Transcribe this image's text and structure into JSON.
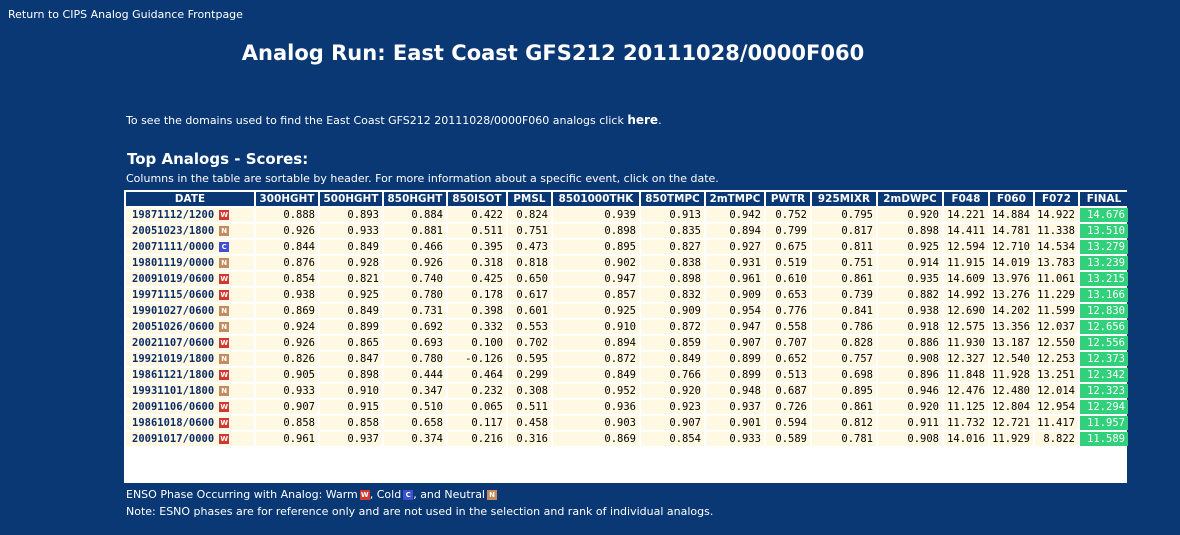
{
  "return_link": "Return to CIPS Analog Guidance Frontpage",
  "title": "Analog Run: East Coast GFS212 20111028/0000F060",
  "domains": {
    "text": "To see the domains used to find the East Coast GFS212 20111028/0000F060 analogs click",
    "link": "here",
    "end": "."
  },
  "section_title": "Top Analogs - Scores:",
  "sort_note": "Columns in the table are sortable by header. For more information about a specific event, click on the date.",
  "table": {
    "headers": [
      "DATE",
      "300HGHT",
      "500HGHT",
      "850HGHT",
      "850ISOT",
      "PMSL",
      "8501000THK",
      "850TMPC",
      "2mTMPC",
      "PWTR",
      "925MIXR",
      "2mDWPC",
      "F048",
      "F060",
      "F072",
      "FINAL"
    ],
    "rows": [
      {
        "date": "19871112/1200",
        "enso": "W",
        "values": [
          "0.888",
          "0.893",
          "0.884",
          "0.422",
          "0.824",
          "0.939",
          "0.913",
          "0.942",
          "0.752",
          "0.795",
          "0.920",
          "14.221",
          "14.884",
          "14.922",
          "14.676"
        ]
      },
      {
        "date": "20051023/1800",
        "enso": "N",
        "values": [
          "0.926",
          "0.933",
          "0.881",
          "0.511",
          "0.751",
          "0.898",
          "0.835",
          "0.894",
          "0.799",
          "0.817",
          "0.898",
          "14.411",
          "14.781",
          "11.338",
          "13.510"
        ]
      },
      {
        "date": "20071111/0000",
        "enso": "C",
        "values": [
          "0.844",
          "0.849",
          "0.466",
          "0.395",
          "0.473",
          "0.895",
          "0.827",
          "0.927",
          "0.675",
          "0.811",
          "0.925",
          "12.594",
          "12.710",
          "14.534",
          "13.279"
        ]
      },
      {
        "date": "19801119/0000",
        "enso": "N",
        "values": [
          "0.876",
          "0.928",
          "0.926",
          "0.318",
          "0.818",
          "0.902",
          "0.838",
          "0.931",
          "0.519",
          "0.751",
          "0.914",
          "11.915",
          "14.019",
          "13.783",
          "13.239"
        ]
      },
      {
        "date": "20091019/0600",
        "enso": "W",
        "values": [
          "0.854",
          "0.821",
          "0.740",
          "0.425",
          "0.650",
          "0.947",
          "0.898",
          "0.961",
          "0.610",
          "0.861",
          "0.935",
          "14.609",
          "13.976",
          "11.061",
          "13.215"
        ]
      },
      {
        "date": "19971115/0600",
        "enso": "W",
        "values": [
          "0.938",
          "0.925",
          "0.780",
          "0.178",
          "0.617",
          "0.857",
          "0.832",
          "0.909",
          "0.653",
          "0.739",
          "0.882",
          "14.992",
          "13.276",
          "11.229",
          "13.166"
        ]
      },
      {
        "date": "19901027/0600",
        "enso": "N",
        "values": [
          "0.869",
          "0.849",
          "0.731",
          "0.398",
          "0.601",
          "0.925",
          "0.909",
          "0.954",
          "0.776",
          "0.841",
          "0.938",
          "12.690",
          "14.202",
          "11.599",
          "12.830"
        ]
      },
      {
        "date": "20051026/0600",
        "enso": "N",
        "values": [
          "0.924",
          "0.899",
          "0.692",
          "0.332",
          "0.553",
          "0.910",
          "0.872",
          "0.947",
          "0.558",
          "0.786",
          "0.918",
          "12.575",
          "13.356",
          "12.037",
          "12.656"
        ]
      },
      {
        "date": "20021107/0600",
        "enso": "W",
        "values": [
          "0.926",
          "0.865",
          "0.693",
          "0.100",
          "0.702",
          "0.894",
          "0.859",
          "0.907",
          "0.707",
          "0.828",
          "0.886",
          "11.930",
          "13.187",
          "12.550",
          "12.556"
        ]
      },
      {
        "date": "19921019/1800",
        "enso": "N",
        "values": [
          "0.826",
          "0.847",
          "0.780",
          "-0.126",
          "0.595",
          "0.872",
          "0.849",
          "0.899",
          "0.652",
          "0.757",
          "0.908",
          "12.327",
          "12.540",
          "12.253",
          "12.373"
        ]
      },
      {
        "date": "19861121/1800",
        "enso": "W",
        "values": [
          "0.905",
          "0.898",
          "0.444",
          "0.464",
          "0.299",
          "0.849",
          "0.766",
          "0.899",
          "0.513",
          "0.698",
          "0.896",
          "11.848",
          "11.928",
          "13.251",
          "12.342"
        ]
      },
      {
        "date": "19931101/1800",
        "enso": "N",
        "values": [
          "0.933",
          "0.910",
          "0.347",
          "0.232",
          "0.308",
          "0.952",
          "0.920",
          "0.948",
          "0.687",
          "0.895",
          "0.946",
          "12.476",
          "12.480",
          "12.014",
          "12.323"
        ]
      },
      {
        "date": "20091106/0600",
        "enso": "W",
        "values": [
          "0.907",
          "0.915",
          "0.510",
          "0.065",
          "0.511",
          "0.936",
          "0.923",
          "0.937",
          "0.726",
          "0.861",
          "0.920",
          "11.125",
          "12.804",
          "12.954",
          "12.294"
        ]
      },
      {
        "date": "19861018/0600",
        "enso": "W",
        "values": [
          "0.858",
          "0.858",
          "0.658",
          "0.117",
          "0.458",
          "0.903",
          "0.907",
          "0.901",
          "0.594",
          "0.812",
          "0.911",
          "11.732",
          "12.721",
          "11.417",
          "11.957"
        ]
      },
      {
        "date": "20091017/0000",
        "enso": "W",
        "values": [
          "0.961",
          "0.937",
          "0.374",
          "0.216",
          "0.316",
          "0.869",
          "0.854",
          "0.933",
          "0.589",
          "0.781",
          "0.908",
          "14.016",
          "11.929",
          "8.822",
          "11.589"
        ]
      }
    ]
  },
  "legend": {
    "prefix": "ENSO Phase Occurring with Analog: Warm",
    "cold": ", Cold",
    "neutral": ", and Neutral"
  },
  "note": "Note: ESNO phases are for reference only and are not used in the selection and rank of individual analogs.",
  "colors": {
    "background": "#0a3875",
    "cell": "#fff8e3",
    "final": "#31d07a",
    "warm": "#cf3a30",
    "cold": "#3f4fd1",
    "neutral": "#c58a5e"
  }
}
